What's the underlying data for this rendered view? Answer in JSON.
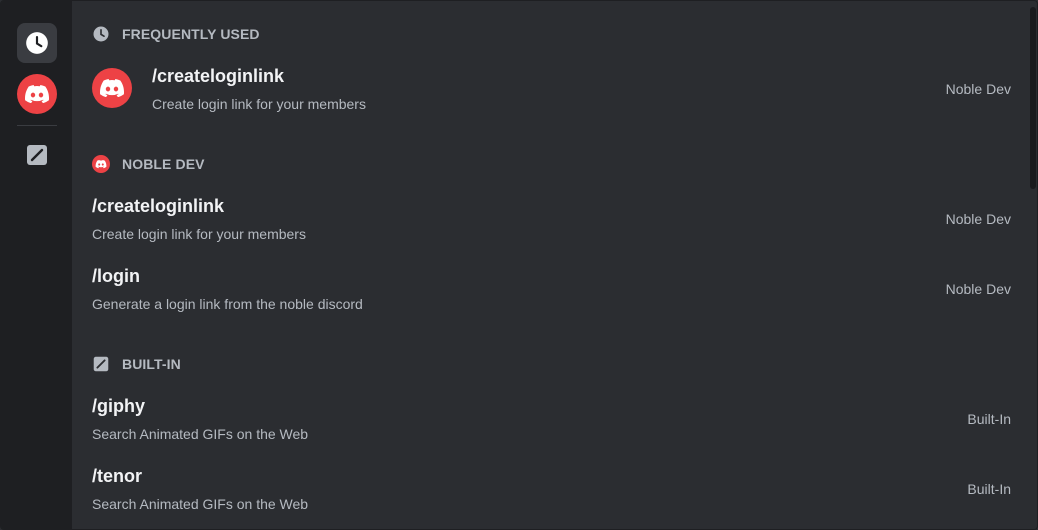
{
  "rail": {
    "icons": [
      "clock-icon",
      "discord-logo-icon",
      "slash-command-icon"
    ]
  },
  "sections": {
    "frequently_used": {
      "title": "FREQUENTLY USED",
      "icon": "clock-icon"
    },
    "noble_dev": {
      "title": "NOBLE DEV",
      "icon": "discord-logo-icon"
    },
    "built_in": {
      "title": "BUILT-IN",
      "icon": "slash-command-icon"
    }
  },
  "commands": {
    "frequent_1": {
      "name": "/createloginlink",
      "description": "Create login link for your members",
      "source": "Noble Dev"
    },
    "noble_1": {
      "name": "/createloginlink",
      "description": "Create login link for your members",
      "source": "Noble Dev"
    },
    "noble_2": {
      "name": "/login",
      "description": "Generate a login link from the noble discord",
      "source": "Noble Dev"
    },
    "builtin_1": {
      "name": "/giphy",
      "description": "Search Animated GIFs on the Web",
      "source": "Built-In"
    },
    "builtin_2": {
      "name": "/tenor",
      "description": "Search Animated GIFs on the Web",
      "source": "Built-In"
    }
  },
  "colors": {
    "accent": "#ed4245",
    "background": "#2b2d31",
    "rail": "#1e1f22",
    "muted_text": "#b5bac1",
    "primary_text": "#f2f3f5"
  }
}
